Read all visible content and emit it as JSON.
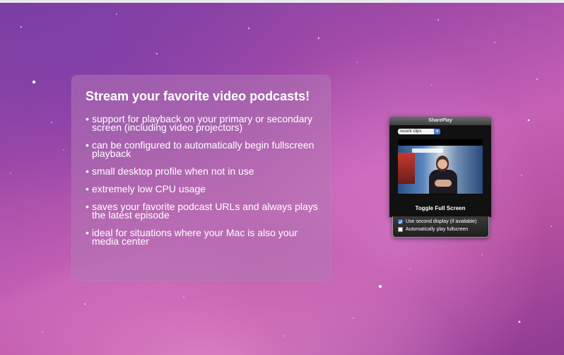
{
  "promo": {
    "title": "Stream your favorite video podcasts!",
    "features": [
      "support for playback on your primary or secondary screen (including video projectors)",
      "can be configured to automatically begin fullscreen playback",
      "small desktop profile when not in use",
      "extremely low CPU usage",
      "saves your favorite podcast URLs and always plays the latest episode",
      "ideal for situations where your Mac is also your media center"
    ],
    "bullet": "•"
  },
  "shareplay": {
    "window_title": "SharePlay",
    "clips_selected": "recent clips",
    "toggle_label": "Toggle Full Screen",
    "options": {
      "second_display_label": "Use second display (if available)",
      "second_display_checked": true,
      "auto_fullscreen_label": "Automatically play fullscreen",
      "auto_fullscreen_checked": false
    }
  },
  "icons": {
    "bullet": "bullet-icon",
    "select_arrow": "chevron-down-icon",
    "checkbox": "checkbox-icon"
  },
  "colors": {
    "panel": "#b076b2",
    "accent": "#2f68cf"
  }
}
